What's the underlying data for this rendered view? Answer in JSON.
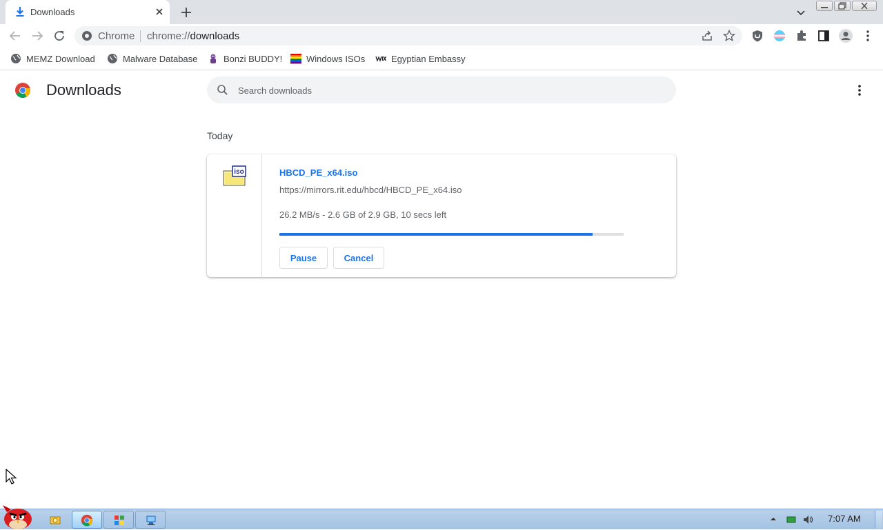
{
  "tab": {
    "title": "Downloads"
  },
  "omnibox": {
    "site_label": "Chrome",
    "url_scheme": "chrome://",
    "url_host": "downloads"
  },
  "bookmarks": [
    {
      "label": "MEMZ Download",
      "icon": "globe-icon"
    },
    {
      "label": "Malware Database",
      "icon": "globe-icon"
    },
    {
      "label": "Bonzi BUDDY!",
      "icon": "bonzi-icon"
    },
    {
      "label": "Windows ISOs",
      "icon": "rainbow-flag-icon"
    },
    {
      "label": "Egyptian Embassy",
      "icon": "wix-icon"
    }
  ],
  "page": {
    "title": "Downloads",
    "search_placeholder": "Search downloads",
    "section_label": "Today"
  },
  "download": {
    "file_name": "HBCD_PE_x64.iso",
    "icon_label": "iso",
    "source_url": "https://mirrors.rit.edu/hbcd/HBCD_PE_x64.iso",
    "status": "26.2 MB/s - 2.6 GB of 2.9 GB, 10 secs left",
    "progress_fraction": 0.91,
    "pause_label": "Pause",
    "cancel_label": "Cancel"
  },
  "taskbar": {
    "clock": "7:07 AM"
  },
  "colors": {
    "accent": "#1a73e8",
    "tabstrip": "#dee1e6",
    "omnibox_bg": "#f1f3f4"
  }
}
